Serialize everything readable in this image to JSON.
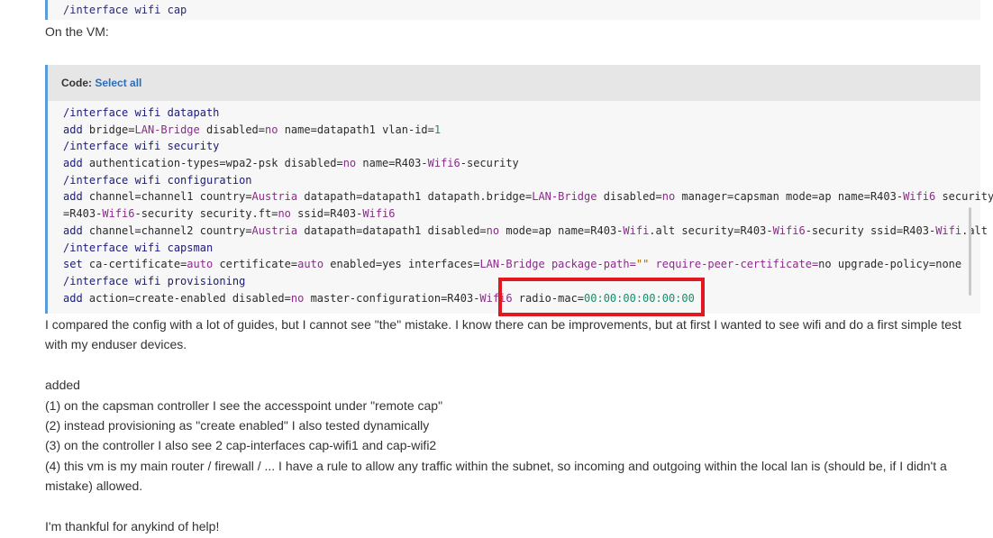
{
  "top_code_line": "/interface wifi cap",
  "intro_text": "On the VM:",
  "code_block": {
    "label": "Code:",
    "select_all": "Select all",
    "lines": [
      "/interface wifi datapath",
      "add bridge=LAN-Bridge disabled=no name=datapath1 vlan-id=1",
      "/interface wifi security",
      "add authentication-types=wpa2-psk disabled=no name=R403-Wifi6-security",
      "/interface wifi configuration",
      "add channel=channel1 country=Austria datapath=datapath1 datapath.bridge=LAN-Bridge disabled=no manager=capsman mode=ap name=R403-Wifi6 security",
      "=R403-Wifi6-security security.ft=no ssid=R403-Wifi6",
      "add channel=channel2 country=Austria datapath=datapath1 disabled=no mode=ap name=R403-Wifi.alt security=R403-Wifi6-security ssid=R403-Wifi.alt",
      "/interface wifi capsman",
      "set ca-certificate=auto certificate=auto enabled=yes interfaces=LAN-Bridge package-path=\"\" require-peer-certificate=no upgrade-policy=none",
      "/interface wifi provisioning",
      "add action=create-enabled disabled=no master-configuration=R403-Wifi6 radio-mac=00:00:00:00:00:00"
    ]
  },
  "paragraph_1": "I compared the config with a lot of guides, but I cannot see \"the\" mistake. I know there can be improvements, but at first I wanted to see wifi and do a first simple test with my enduser devices.",
  "added_label": "added",
  "added_items": [
    "(1) on the capsman controller I see the accesspoint under \"remote cap\"",
    "(2) instead provisioning as \"create enabled\" I also tested dynamically",
    "(3) on the controller I also see 2 cap-interfaces cap-wifi1 and cap-wifi2",
    "(4) this vm is my main router / firewall / ... I have a rule to allow any traffic within the subnet, so incoming and outgoing within the local lan is (should be, if I didn't a mistake) allowed."
  ],
  "closing_text": "I'm thankful for anykind of help!",
  "colors": {
    "accent_border": "#5a9bd8",
    "highlight": "#e0181f",
    "link": "#2a6ebb"
  }
}
